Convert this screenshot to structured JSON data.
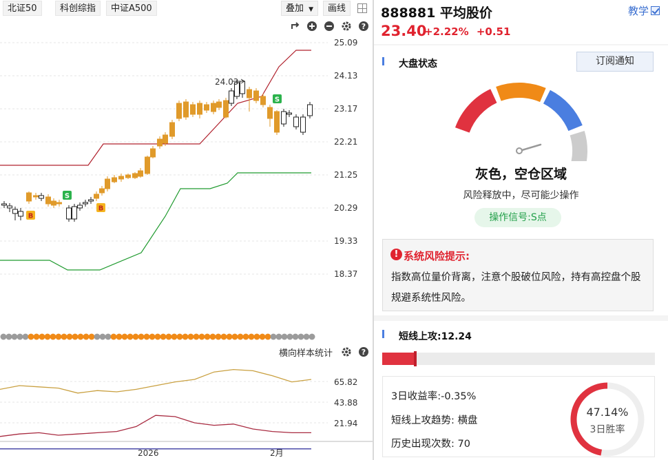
{
  "topbar": {
    "index_tabs": [
      "北证50",
      "科创综指",
      "中证A500"
    ],
    "overlay_label": "叠加",
    "line_label": "画线"
  },
  "chart": {
    "price_axis_ticks": [
      "25.09",
      "24.13",
      "23.17",
      "22.21",
      "21.25",
      "20.29",
      "19.33",
      "18.37"
    ],
    "high_annotation": "24.03",
    "signal_buy": "B",
    "signal_sell": "S",
    "colors": {
      "up": "#e09a2a",
      "down": "#222222",
      "upper_band": "#b0202c",
      "lower_band": "#1f9a2e",
      "signal_green": "#2bb24c",
      "signal_orange": "#f5a623"
    }
  },
  "sub_chart": {
    "title": "横向样本统计",
    "axis_ticks": [
      "65.82",
      "43.88",
      "21.94"
    ],
    "x_labels": [
      "2026",
      "2月"
    ],
    "colors": {
      "line1": "#c9a040",
      "line2": "#a82a40",
      "line3": "#3a3aa0"
    }
  },
  "chart_data": {
    "type": "line",
    "title": "",
    "series": [
      {
        "name": "",
        "values": [
          52,
          55,
          54,
          53,
          49,
          51,
          50,
          52,
          55,
          58,
          60,
          66,
          68,
          67,
          63,
          58,
          60
        ]
      },
      {
        "name": "",
        "values": [
          14,
          16,
          17,
          15,
          16,
          17,
          18,
          22,
          31,
          30,
          25,
          23,
          24,
          20,
          18,
          17,
          17
        ]
      },
      {
        "name": "",
        "values": [
          4,
          4,
          4,
          4,
          4,
          4,
          4,
          4,
          4,
          4,
          4,
          4,
          4,
          4,
          4,
          4,
          4
        ]
      }
    ],
    "ylim": [
      10,
      75
    ],
    "xlabel": "",
    "ylabel": ""
  },
  "header": {
    "stock": "888881 平均股价",
    "teach": "教学",
    "price": "23.40",
    "change_pct": "+2.22%",
    "change_abs": "+0.51"
  },
  "market": {
    "title": "大盘状态",
    "subscribe": "订阅通知",
    "state": "灰色，空仓区域",
    "desc": "风险释放中，尽可能少操作",
    "signal": "操作信号:S点",
    "gauge_colors": [
      "#e0323f",
      "#f08a17",
      "#4a7ee0",
      "#cccccc"
    ],
    "gauge_pointer_level": 0.78
  },
  "risk": {
    "title": "系统风险提示:",
    "text": "指数高位量价背离，注意个股破位风险，持有高控盘个股规避系统性风险。"
  },
  "short": {
    "title": "短线上攻:12.24",
    "progress": 0.1224,
    "ret3d": "3日收益率:-0.35%",
    "trend": "短线上攻趋势: 横盘",
    "count": "历史出现次数: 70",
    "winrate": "47.14%",
    "winrate_value": 47.14,
    "winrate_label": "3日胜率"
  }
}
